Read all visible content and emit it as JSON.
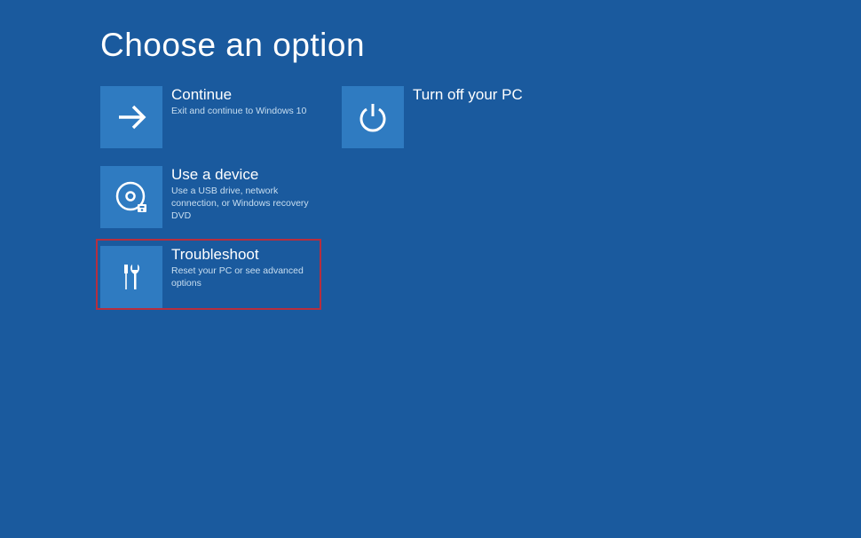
{
  "heading": "Choose an option",
  "tiles": {
    "continue": {
      "title": "Continue",
      "desc": "Exit and continue to Windows 10"
    },
    "turnoff": {
      "title": "Turn off your PC",
      "desc": ""
    },
    "usedevice": {
      "title": "Use a device",
      "desc": "Use a USB drive, network connection, or Windows recovery DVD"
    },
    "troubleshoot": {
      "title": "Troubleshoot",
      "desc": "Reset your PC or see advanced options"
    }
  },
  "colors": {
    "background": "#1a5a9e",
    "tile": "#2f7bc1",
    "highlight": "#b72e3e"
  }
}
